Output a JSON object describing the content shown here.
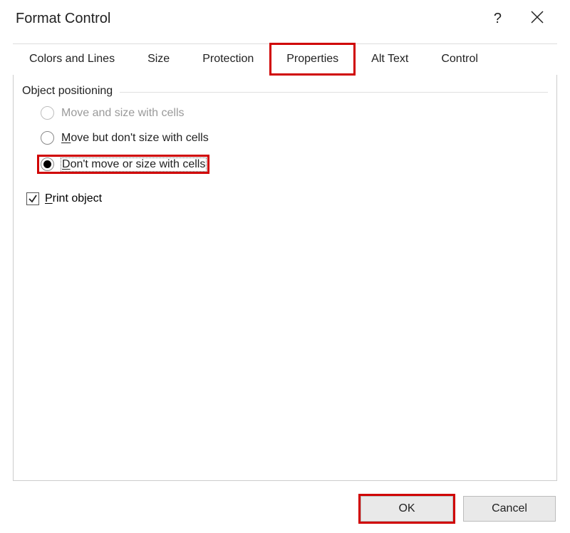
{
  "dialog": {
    "title": "Format Control"
  },
  "tabs": {
    "items": [
      {
        "label": "Colors and Lines"
      },
      {
        "label": "Size"
      },
      {
        "label": "Protection"
      },
      {
        "label": "Properties",
        "active": true
      },
      {
        "label": "Alt Text"
      },
      {
        "label": "Control"
      }
    ]
  },
  "properties": {
    "section_label": "Object positioning",
    "options": {
      "opt1": "Move and size with cells",
      "opt2_prefix": "M",
      "opt2_rest": "ove but don't size with cells",
      "opt3_prefix": "D",
      "opt3_rest": "on't move or size with cells"
    },
    "print_prefix": "P",
    "print_rest": "rint object"
  },
  "buttons": {
    "ok": "OK",
    "cancel": "Cancel"
  }
}
